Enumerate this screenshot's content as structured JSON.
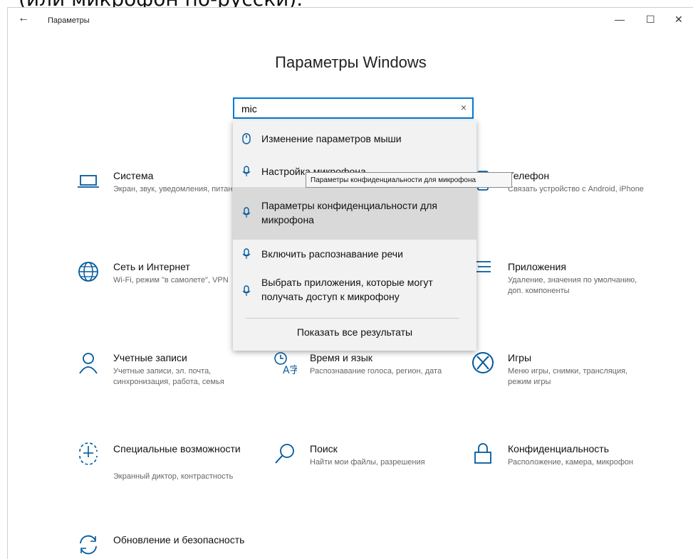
{
  "caption": "(или микрофон по-русски).",
  "window": {
    "title": "Параметры",
    "back_glyph": "←",
    "minimize_glyph": "—",
    "maximize_glyph": "☐",
    "close_glyph": "✕"
  },
  "heading": "Параметры Windows",
  "search": {
    "value": "mic",
    "clear_glyph": "×"
  },
  "tiles": [
    {
      "title": "Система",
      "desc": "Экран, звук, уведомления, питание",
      "icon": "laptop-icon"
    },
    {
      "title": "Телефон",
      "desc": "Связать устройство с Android, iPhone",
      "icon": "phone-icon"
    },
    {
      "title": "Сеть и Интернет",
      "desc": "Wi-Fi, режим \"в самолете\", VPN",
      "icon": "globe-icon"
    },
    {
      "title": "Приложения",
      "desc": "Удаление, значения по умолчанию, доп. компоненты",
      "icon": "apps-icon"
    },
    {
      "title": "Учетные записи",
      "desc": "Учетные записи, эл. почта, синхронизация, работа, семья",
      "icon": "person-icon"
    },
    {
      "title": "Время и язык",
      "desc": "Распознавание голоса, регион, дата",
      "icon": "time-language-icon"
    },
    {
      "title": "Игры",
      "desc": "Меню игры, снимки, трансляция, режим игры",
      "icon": "xbox-icon"
    },
    {
      "title": "Специальные возможности",
      "desc": "Экранный диктор, контрастность",
      "icon": "accessibility-icon"
    },
    {
      "title": "Поиск",
      "desc": "Найти мои файлы, разрешения",
      "icon": "search-icon"
    },
    {
      "title": "Конфиденциальность",
      "desc": "Расположение, камера, микрофон",
      "icon": "lock-icon"
    },
    {
      "title": "Обновление и безопасность",
      "desc": "",
      "icon": "sync-icon"
    }
  ],
  "results": [
    {
      "label": "Изменение параметров мыши",
      "icon": "mouse-icon",
      "highlighted": false
    },
    {
      "label": "Настройка микрофона",
      "icon": "microphone-icon",
      "highlighted": false
    },
    {
      "label": "Параметры конфиденциальности для микрофона",
      "icon": "microphone-icon",
      "highlighted": true
    },
    {
      "label": "Включить распознавание речи",
      "icon": "microphone-icon",
      "highlighted": false
    },
    {
      "label": "Выбрать приложения, которые могут получать доступ к микрофону",
      "icon": "microphone-icon",
      "highlighted": false
    }
  ],
  "show_all": "Показать все результаты",
  "tooltip": "Параметры конфиденциальности для микрофона",
  "colors": {
    "accent": "#0078d7",
    "icon": "#005a9e"
  }
}
